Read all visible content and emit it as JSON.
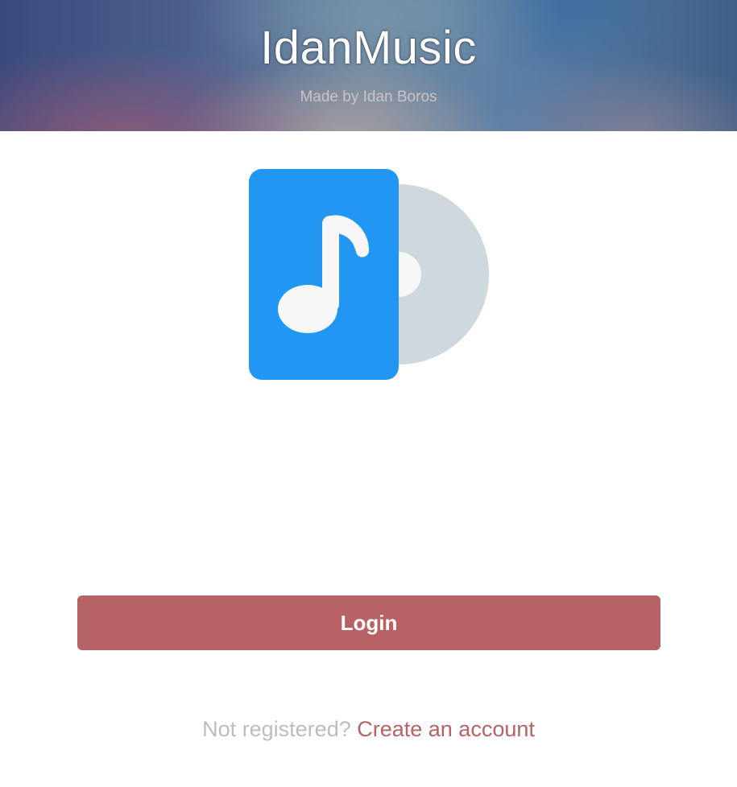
{
  "header": {
    "title": "IdanMusic",
    "subtitle": "Made by Idan Boros"
  },
  "logo": {
    "icon": "music-file-disc-icon",
    "colors": {
      "file": "#2196f3",
      "disc": "#cfd8dc",
      "note": "#f7f7f7"
    }
  },
  "login": {
    "button_label": "Login",
    "button_color": "#b76265"
  },
  "register": {
    "prompt": "Not registered?",
    "link_label": "Create an account",
    "link_color": "#b76265"
  }
}
